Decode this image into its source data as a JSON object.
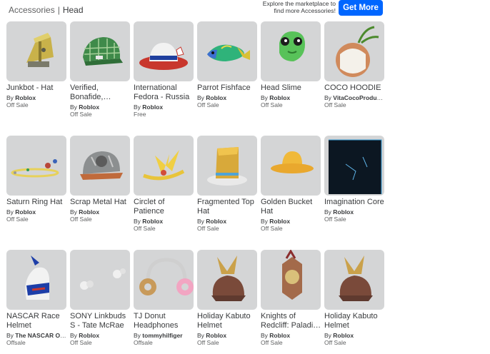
{
  "breadcrumb": {
    "root": "Accessories",
    "separator": "|",
    "current": "Head"
  },
  "promo": {
    "text": "Explore the marketplace to find more Accessories!",
    "button": "Get More"
  },
  "items": [
    {
      "name": "Junkbot - Hat",
      "by_prefix": "By",
      "creator": "Roblox",
      "status": "Off Sale",
      "icon": "junkbot-hat"
    },
    {
      "name": "Verified, Bonafide,…",
      "by_prefix": "By",
      "creator": "Roblox",
      "status": "Off Sale",
      "icon": "plaid-cap"
    },
    {
      "name": "International Fedora - Russia",
      "by_prefix": "By",
      "creator": "Roblox",
      "status": "Free",
      "icon": "fedora-russia"
    },
    {
      "name": "Parrot Fishface",
      "by_prefix": "By",
      "creator": "Roblox",
      "status": "Off Sale",
      "icon": "parrot-fish"
    },
    {
      "name": "Head Slime",
      "by_prefix": "By",
      "creator": "Roblox",
      "status": "Off Sale",
      "icon": "head-slime"
    },
    {
      "name": "COCO HOODIE",
      "by_prefix": "By",
      "creator": "VitaCocoProducti…",
      "status": "Off Sale",
      "icon": "coconut"
    },
    {
      "name": "Saturn Ring Hat",
      "by_prefix": "By",
      "creator": "Roblox",
      "status": "Off Sale",
      "icon": "saturn-ring"
    },
    {
      "name": "Scrap Metal Hat",
      "by_prefix": "By",
      "creator": "Roblox",
      "status": "Off Sale",
      "icon": "scrap-metal-hat"
    },
    {
      "name": "Circlet of Patience",
      "by_prefix": "By",
      "creator": "Roblox",
      "status": "Off Sale",
      "icon": "gold-circlet"
    },
    {
      "name": "Fragmented Top Hat",
      "by_prefix": "By",
      "creator": "Roblox",
      "status": "Off Sale",
      "icon": "top-hat"
    },
    {
      "name": "Golden Bucket Hat",
      "by_prefix": "By",
      "creator": "Roblox",
      "status": "Off Sale",
      "icon": "bucket-hat"
    },
    {
      "name": "Imagination Core",
      "by_prefix": "By",
      "creator": "Roblox",
      "status": "Off Sale",
      "icon": "dark-cube"
    },
    {
      "name": "NASCAR Race Helmet",
      "by_prefix": "By",
      "creator": "The NASCAR Offi…",
      "status": "Offsale",
      "icon": "race-helmet"
    },
    {
      "name": "SONY Linkbuds S - Tate McRae",
      "by_prefix": "By",
      "creator": "Roblox",
      "status": "Off Sale",
      "icon": "earbuds"
    },
    {
      "name": "TJ Donut Headphones",
      "by_prefix": "By",
      "creator": "tommyhilfiger",
      "status": "Offsale",
      "icon": "donut-headphones"
    },
    {
      "name": "Holiday Kabuto Helmet",
      "by_prefix": "By",
      "creator": "Roblox",
      "status": "Off Sale",
      "icon": "kabuto-helmet"
    },
    {
      "name": "Knights of Redcliff: Paladi…",
      "by_prefix": "By",
      "creator": "Roblox",
      "status": "Off Sale",
      "icon": "paladin-helm"
    },
    {
      "name": "Holiday Kabuto Helmet",
      "by_prefix": "By",
      "creator": "Roblox",
      "status": "Off Sale",
      "icon": "kabuto-helmet"
    }
  ],
  "colors": {
    "thumb_bg": "#d4d5d6",
    "accent": "#0066ff"
  }
}
